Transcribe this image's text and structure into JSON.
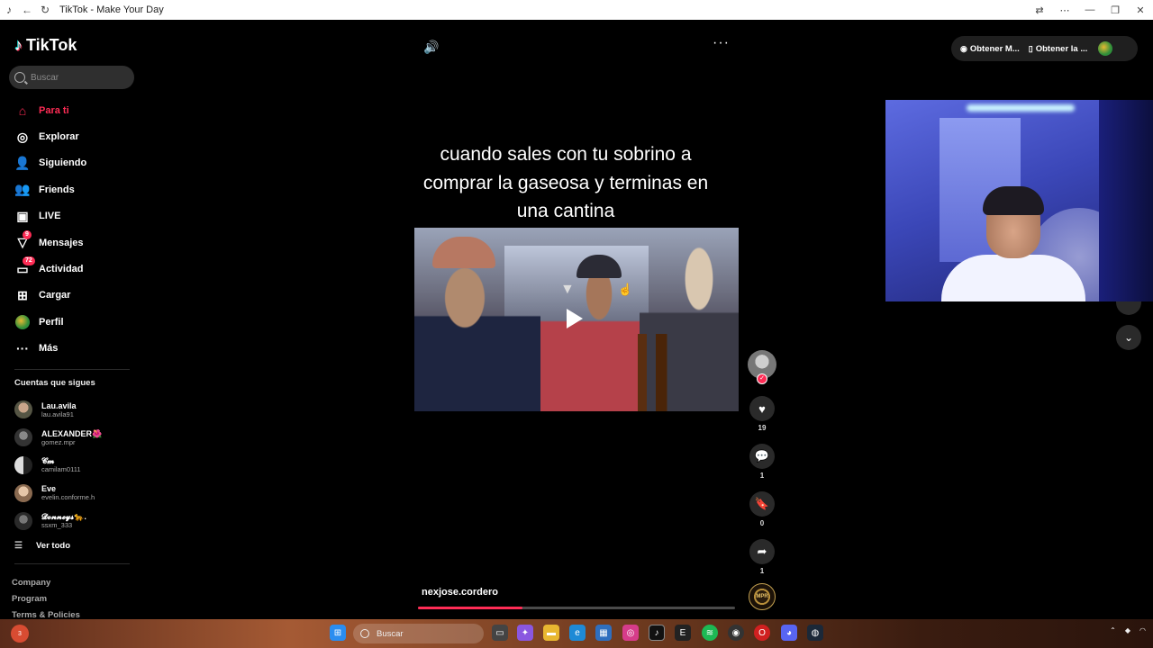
{
  "browser": {
    "tab_title": "TikTok - Make Your Day"
  },
  "sidebar": {
    "logo_text": "TikTok",
    "search_placeholder": "Buscar",
    "nav": [
      {
        "label": "Para ti",
        "icon": "home-icon",
        "active": true
      },
      {
        "label": "Explorar",
        "icon": "compass-icon"
      },
      {
        "label": "Siguiendo",
        "icon": "following-icon"
      },
      {
        "label": "Friends",
        "icon": "friends-icon"
      },
      {
        "label": "LIVE",
        "icon": "live-icon"
      },
      {
        "label": "Mensajes",
        "icon": "messages-icon",
        "badge": "9"
      },
      {
        "label": "Actividad",
        "icon": "activity-icon",
        "badge": "72"
      },
      {
        "label": "Cargar",
        "icon": "upload-icon"
      },
      {
        "label": "Perfil",
        "icon": "profile-icon"
      },
      {
        "label": "Más",
        "icon": "more-icon"
      }
    ],
    "following_title": "Cuentas que sigues",
    "following": [
      {
        "name": "Lau.avila",
        "handle": "lau.avila91"
      },
      {
        "name": "ALEXANDER🌺",
        "handle": "gomez.mpr"
      },
      {
        "name": "𝓒𝓶",
        "handle": "camilam0111"
      },
      {
        "name": "Eve",
        "handle": "evelin.conforme.h"
      },
      {
        "name": "𝓓𝓸𝓷𝓷𝓮𝔂𝓼🐆.",
        "handle": "ssxm_333"
      }
    ],
    "see_all": "Ver todo",
    "footer_links": [
      "Company",
      "Program",
      "Terms & Policies"
    ]
  },
  "video": {
    "caption": "cuando sales con tu sobrino a comprar la gaseosa y terminas en una cantina",
    "author": "nexjose.cordero",
    "progress": 0.33,
    "likes": "19",
    "comments": "1",
    "saves": "0",
    "shares": "1",
    "music_disc_text": "MPR"
  },
  "top_right": {
    "pill1": "Obtener M...",
    "pill2": "Obtener la ..."
  },
  "taskbar": {
    "search_placeholder": "Buscar",
    "notification_badge": "3"
  },
  "colors": {
    "accent": "#fe2c55",
    "background": "#000000"
  }
}
